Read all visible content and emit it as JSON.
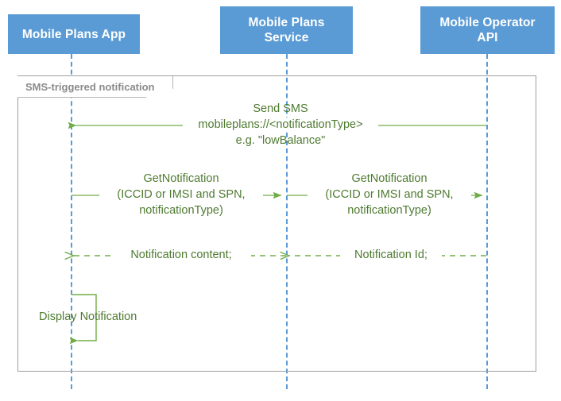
{
  "diagram": {
    "type": "uml-sequence-diagram",
    "colors": {
      "participant_fill": "#5B9BD5",
      "participant_text": "#FFFFFF",
      "lifeline": "#5B9BD5",
      "message_line": "#70AD47",
      "message_text": "#4E7A30",
      "frame_border": "#9E9E9E",
      "frame_label_text": "#8A8A8A",
      "background": "#FFFFFF"
    },
    "participants": [
      {
        "id": "app",
        "label": "Mobile Plans App"
      },
      {
        "id": "service",
        "label": "Mobile Plans\nService"
      },
      {
        "id": "operator",
        "label": "Mobile Operator\nAPI"
      }
    ],
    "fragment": {
      "label": "SMS-triggered notification"
    },
    "messages": [
      {
        "id": "m1",
        "from": "operator",
        "to": "app",
        "style": "solid",
        "direction": "left",
        "label_line1": "Send SMS",
        "label_line2": "mobileplans://<notificationType>",
        "label_line3": "e.g. \"lowBalance\""
      },
      {
        "id": "m2",
        "from": "app",
        "to": "service",
        "style": "solid",
        "direction": "right",
        "label_line1": "GetNotification",
        "label_line2": "(ICCID or IMSI and SPN,",
        "label_line3": "notificationType)"
      },
      {
        "id": "m3",
        "from": "service",
        "to": "operator",
        "style": "solid",
        "direction": "right",
        "label_line1": "GetNotification",
        "label_line2": "(ICCID or IMSI and SPN,",
        "label_line3": "notificationType)"
      },
      {
        "id": "m4",
        "from": "operator",
        "to": "service",
        "style": "dashed",
        "direction": "left",
        "label_line1": "Notification Id;"
      },
      {
        "id": "m5",
        "from": "service",
        "to": "app",
        "style": "dashed",
        "direction": "left",
        "label_line1": "Notification content;"
      },
      {
        "id": "m6",
        "from": "app",
        "to": "app",
        "style": "self",
        "direction": "left",
        "label_line1": "Display Notification"
      }
    ]
  }
}
